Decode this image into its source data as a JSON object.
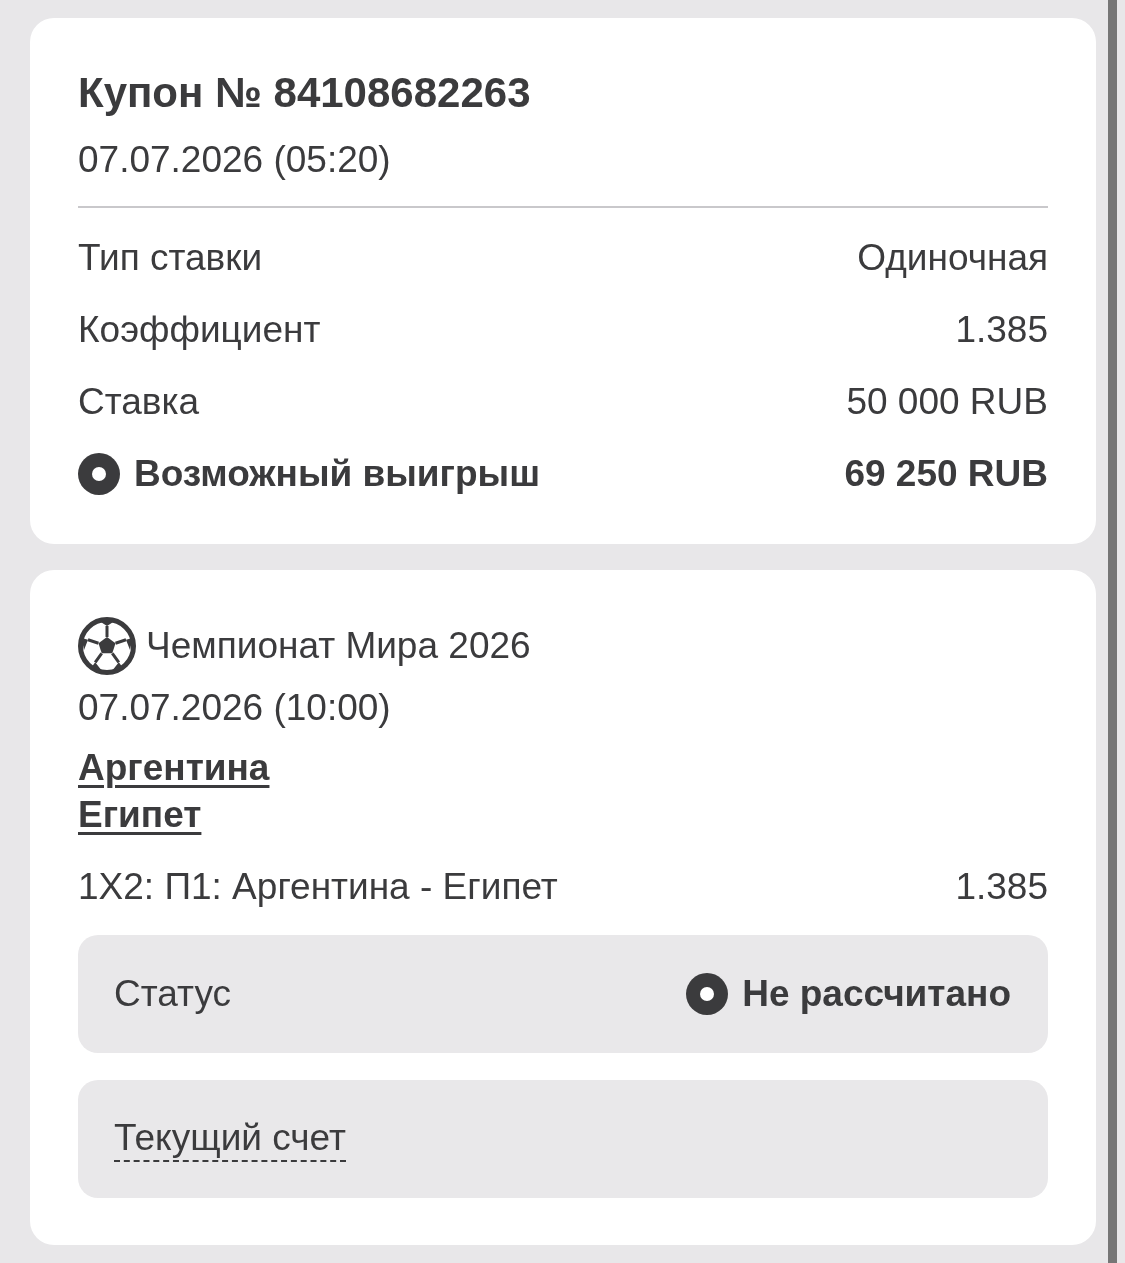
{
  "coupon": {
    "title": "Купон № 84108682263",
    "date": "07.07.2026 (05:20)",
    "rows": [
      {
        "kind": "plain",
        "label": "Тип ставки",
        "value": "Одиночная"
      },
      {
        "kind": "plain",
        "label": "Коэффициент",
        "value": "1.385"
      },
      {
        "kind": "plain",
        "label": "Ставка",
        "value": "50 000 RUB"
      },
      {
        "kind": "highlight",
        "label": "Возможный выигрыш",
        "value": "69 250 RUB"
      }
    ]
  },
  "event": {
    "league": "Чемпионат Мира 2026",
    "date": "07.07.2026 (10:00)",
    "teams": [
      "Аргентина",
      "Египет"
    ],
    "market": "1X2: П1: Аргентина - Египет",
    "odds": "1.385",
    "status": {
      "label": "Статус",
      "value": "Не рассчитано"
    },
    "score": {
      "label": "Текущий счет"
    }
  }
}
